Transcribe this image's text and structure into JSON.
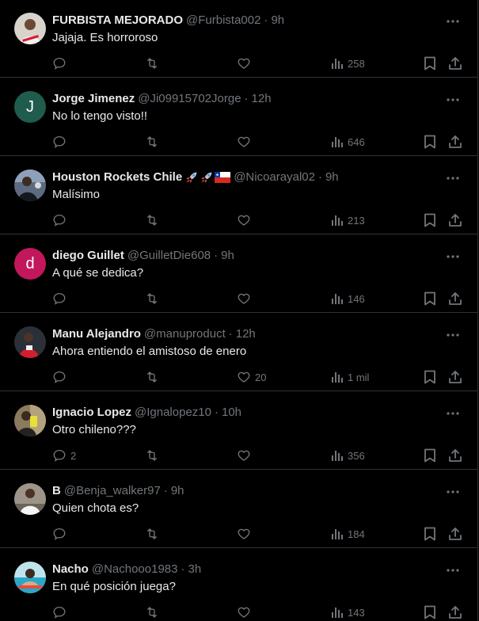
{
  "colors": {
    "background": "#000000",
    "primary_text": "#e7e9ea",
    "secondary_text": "#71767b",
    "divider": "#2f3336"
  },
  "tweets": [
    {
      "name": "FURBISTA MEJORADO",
      "handle": "@Furbista002",
      "time": "9h",
      "text": "Jajaja. Es horroroso",
      "replies": "",
      "likes": "",
      "views": "258",
      "avatar": "photo-river-jersey"
    },
    {
      "name": "Jorge Jimenez",
      "handle": "@Ji09915702Jorge",
      "time": "12h",
      "text": "No lo tengo visto!!",
      "replies": "",
      "likes": "",
      "views": "646",
      "avatar": "initial",
      "avatar_initial": "J",
      "avatar_color": "#1f5c4d"
    },
    {
      "name": "Houston Rockets Chile",
      "handle": "@Nicoarayal02",
      "time": "9h",
      "text": "Malísimo",
      "replies": "",
      "likes": "",
      "views": "213",
      "avatar": "photo-person",
      "emoji": [
        "rocket-icon",
        "rocket-icon",
        "chile-flag-icon"
      ]
    },
    {
      "name": "diego Guillet",
      "handle": "@GuilletDie608",
      "time": "9h",
      "text": "A qué se dedica?",
      "replies": "",
      "likes": "",
      "views": "146",
      "avatar": "initial",
      "avatar_initial": "d",
      "avatar_color": "#c2185b"
    },
    {
      "name": "Manu Alejandro",
      "handle": "@manuproduct",
      "time": "12h",
      "text": "Ahora entiendo el amistoso de enero",
      "replies": "",
      "likes": "20",
      "views": "1 mil",
      "avatar": "photo-red-player"
    },
    {
      "name": "Ignacio Lopez",
      "handle": "@Ignalopez10",
      "time": "10h",
      "text": "Otro chileno???",
      "replies": "2",
      "likes": "",
      "views": "356",
      "avatar": "photo-yellow"
    },
    {
      "name": "B",
      "handle": "@Benja_walker97",
      "time": "9h",
      "text": "Quien chota es?",
      "replies": "",
      "likes": "",
      "views": "184",
      "avatar": "photo-white-shirt"
    },
    {
      "name": "Nacho",
      "handle": "@Nachooo1983",
      "time": "3h",
      "text": "En qué posición juega?",
      "replies": "",
      "likes": "",
      "views": "143",
      "avatar": "photo-pool"
    }
  ]
}
